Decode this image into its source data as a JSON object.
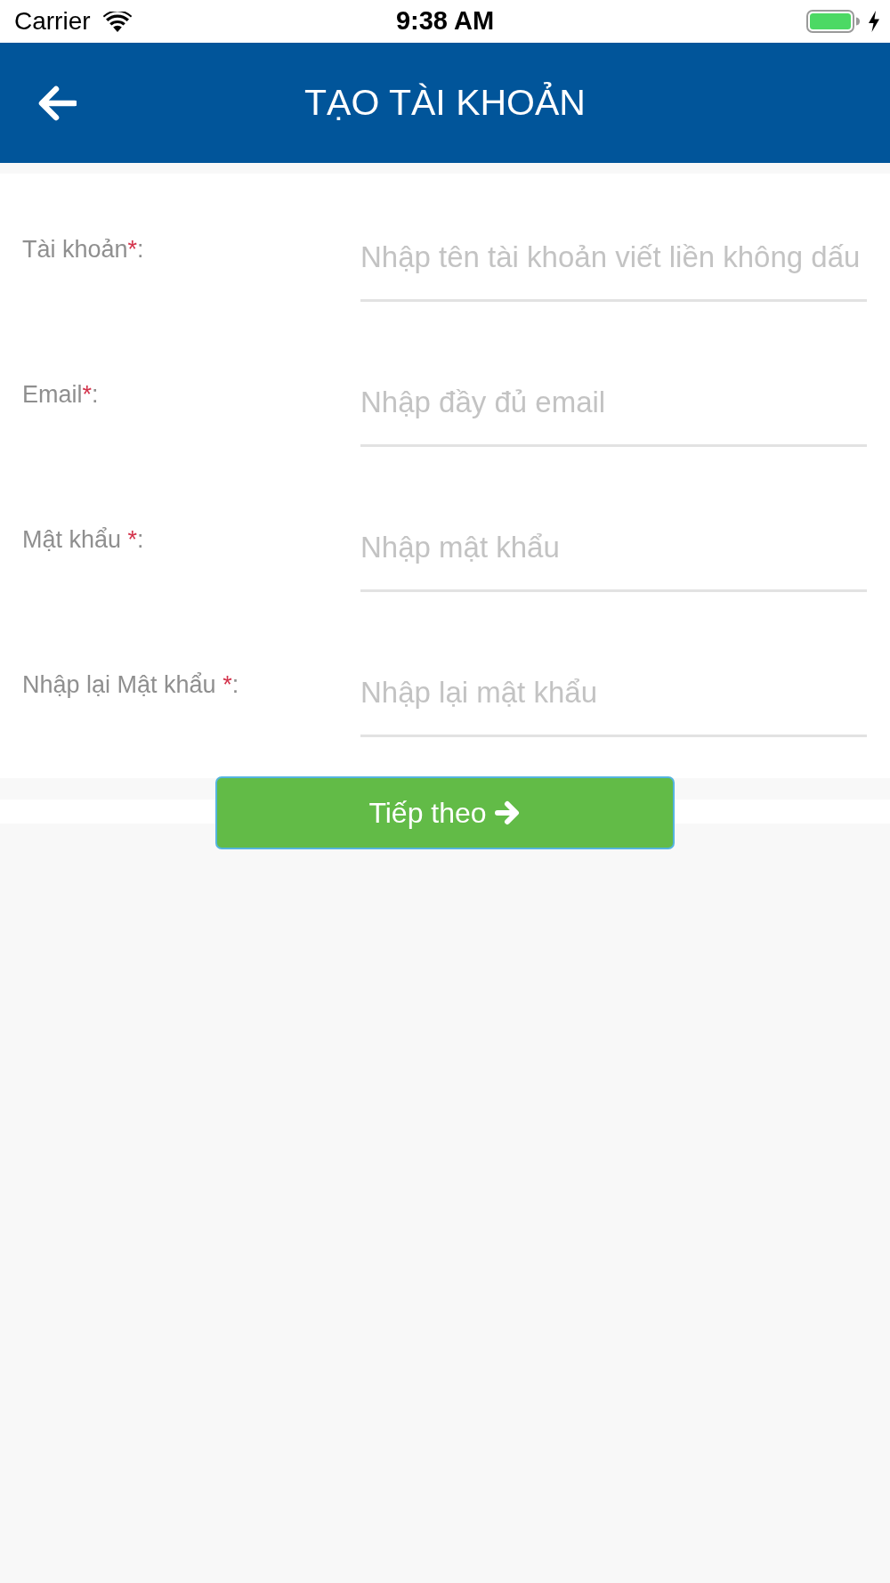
{
  "status_bar": {
    "carrier": "Carrier",
    "time": "9:38 AM",
    "charging": true
  },
  "header": {
    "title": "TẠO TÀI KHOẢN"
  },
  "fields": [
    {
      "label": "Tài khoản",
      "required_mark": "*",
      "suffix": ":",
      "placeholder": "Nhập tên tài khoản viết liền không dấu"
    },
    {
      "label": "Email",
      "required_mark": "*",
      "suffix": ":",
      "placeholder": "Nhập đầy đủ email"
    },
    {
      "label": "Mật khẩu ",
      "required_mark": "*",
      "suffix": ":",
      "placeholder": "Nhập mật khẩu"
    },
    {
      "label": "Nhập lại Mật khẩu ",
      "required_mark": "*",
      "suffix": ":",
      "placeholder": "Nhập lại mật khẩu"
    }
  ],
  "next_button": {
    "label": "Tiếp theo"
  }
}
